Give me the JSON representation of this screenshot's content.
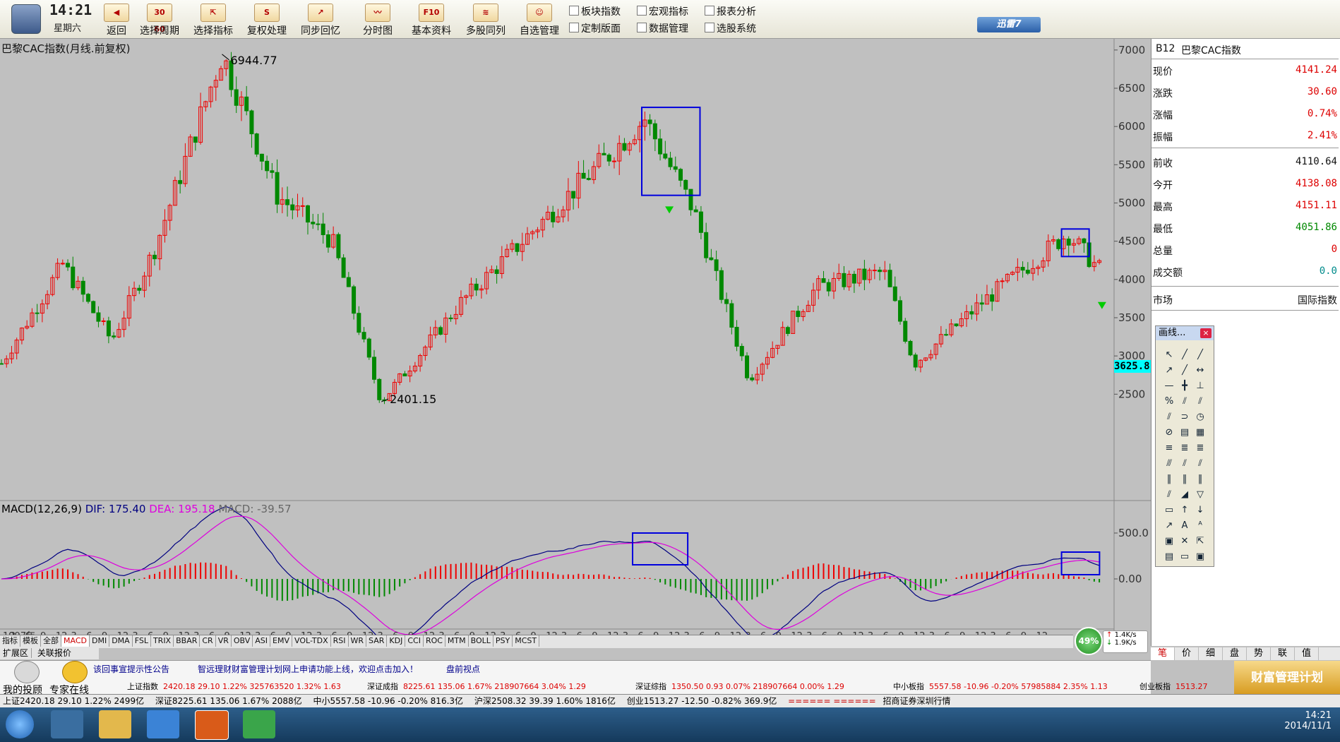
{
  "clock": {
    "time": "14:21",
    "weekday": "星期六"
  },
  "toolbar": {
    "buttons": [
      {
        "label": "返回",
        "icon": "back-arrow-icon",
        "badge": ""
      },
      {
        "label": "选择周期",
        "icon": "calendar-icon",
        "badge": "30 60"
      },
      {
        "label": "选择指标",
        "icon": "indicator-pointer-icon",
        "badge": ""
      },
      {
        "label": "复权处理",
        "icon": "restore-rights-icon",
        "badge": "S"
      },
      {
        "label": "同步回忆",
        "icon": "sync-chart-icon",
        "badge": ""
      },
      {
        "label": "分时图",
        "icon": "intraday-chart-icon",
        "badge": ""
      },
      {
        "label": "基本资料",
        "icon": "f10-icon",
        "badge": "F10"
      },
      {
        "label": "多股同列",
        "icon": "multi-stock-icon",
        "badge": ""
      },
      {
        "label": "自选管理",
        "icon": "watchlist-icon",
        "badge": ""
      }
    ],
    "mini": [
      "板块指数",
      "宏观指标",
      "报表分析",
      "定制版面",
      "数据管理",
      "选股系统"
    ],
    "xunlei": "迅雷7"
  },
  "chart": {
    "title": "巴黎CAC指数(月线.前复权)",
    "high_label": "6944.77",
    "low_label": "2401.15",
    "price_tag": "3625.8",
    "y_ticks": [
      "7000",
      "6500",
      "6000",
      "5500",
      "5000",
      "4500",
      "4000",
      "3500",
      "3000",
      "2500"
    ],
    "macd": {
      "name": "MACD(12,26,9)",
      "dif": "DIF: 175.40",
      "dea": "DEA: 195.18",
      "macd": "MACD: -39.57"
    },
    "macd_ticks": [
      "500.0",
      "0.00"
    ],
    "x_start": "1997年",
    "x_labels": [
      "3",
      "6",
      "9",
      "12",
      "3",
      "6",
      "9",
      "12",
      "3",
      "6",
      "9",
      "12",
      "3",
      "6",
      "9",
      "12",
      "3",
      "6",
      "9",
      "12",
      "3",
      "6",
      "9",
      "12",
      "3",
      "6",
      "9",
      "12",
      "3",
      "6",
      "9",
      "12",
      "3",
      "6",
      "9",
      "12",
      "3",
      "6",
      "9",
      "12",
      "3",
      "6",
      "9",
      "12",
      "3",
      "6",
      "9",
      "12",
      "3",
      "6",
      "9",
      "12",
      "3",
      "6",
      "9",
      "12",
      "3",
      "6",
      "9",
      "12",
      "3",
      "6",
      "9",
      "12",
      "3",
      "6",
      "9",
      "12"
    ]
  },
  "chart_data": {
    "type": "candlestick",
    "title": "巴黎CAC指数(月线.前复权)",
    "ylim": [
      2300,
      7100
    ],
    "approx_close_path": [
      {
        "x": 1997.0,
        "y": 2900
      },
      {
        "x": 1998.0,
        "y": 4200
      },
      {
        "x": 1998.8,
        "y": 3200
      },
      {
        "x": 1999.5,
        "y": 4400
      },
      {
        "x": 2000.6,
        "y": 6944.77
      },
      {
        "x": 2001.5,
        "y": 5100
      },
      {
        "x": 2002.4,
        "y": 4500
      },
      {
        "x": 2003.2,
        "y": 2401.15
      },
      {
        "x": 2004.5,
        "y": 3700
      },
      {
        "x": 2005.5,
        "y": 4500
      },
      {
        "x": 2006.5,
        "y": 5300
      },
      {
        "x": 2007.5,
        "y": 6100
      },
      {
        "x": 2008.3,
        "y": 4900
      },
      {
        "x": 2009.2,
        "y": 2700
      },
      {
        "x": 2010.3,
        "y": 3900
      },
      {
        "x": 2011.4,
        "y": 4100
      },
      {
        "x": 2011.9,
        "y": 2900
      },
      {
        "x": 2013.0,
        "y": 3700
      },
      {
        "x": 2014.4,
        "y": 4600
      },
      {
        "x": 2014.9,
        "y": 4141.24
      }
    ],
    "macd_summary": {
      "DIF": 175.4,
      "DEA": 195.18,
      "MACD": -39.57
    }
  },
  "quote": {
    "code": "B12",
    "name": "巴黎CAC指数",
    "rows": [
      {
        "k": "现价",
        "v": "4141.24",
        "c": "red"
      },
      {
        "k": "涨跌",
        "v": "30.60",
        "c": "red"
      },
      {
        "k": "涨幅",
        "v": "0.74%",
        "c": "red"
      },
      {
        "k": "振幅",
        "v": "2.41%",
        "c": "red"
      },
      {
        "k": "前收",
        "v": "4110.64",
        "c": "black"
      },
      {
        "k": "今开",
        "v": "4138.08",
        "c": "red"
      },
      {
        "k": "最高",
        "v": "4151.11",
        "c": "red"
      },
      {
        "k": "最低",
        "v": "4051.86",
        "c": "green"
      },
      {
        "k": "总量",
        "v": "0",
        "c": "red"
      },
      {
        "k": "成交额",
        "v": "0.0",
        "c": "teal"
      }
    ],
    "market_k": "市场",
    "market_v": "国际指数"
  },
  "palette": {
    "title": "画线...",
    "close": "×"
  },
  "tabs": [
    "指标",
    "模板",
    "全部",
    "MACD",
    "DMI",
    "DMA",
    "FSL",
    "TRIX",
    "BBAR",
    "CR",
    "VR",
    "OBV",
    "ASI",
    "EMV",
    "VOL-TDX",
    "RSI",
    "WR",
    "SAR",
    "KDJ",
    "CCI",
    "ROC",
    "MTM",
    "BOLL",
    "PSY",
    "MCST"
  ],
  "subtabs": [
    "扩展区",
    "关联报价"
  ],
  "rtabs": [
    "笔",
    "价",
    "细",
    "盘",
    "势",
    "联",
    "值"
  ],
  "netspeed": {
    "pct": "49%",
    "up": "1.4K/s",
    "down": "1.9K/s"
  },
  "bottom": {
    "invest_label": "我的投顾",
    "expert_label": "专家在线",
    "notice1": "该回事宣提示性公告",
    "notice2": "智远理财财富管理计划网上申请功能上线，欢迎点击加入！",
    "notice3": "盘前视点",
    "tickers": [
      {
        "name": "上证指数",
        "v": "2420.18  29.10  1.22%  325763520  1.32%  1.63"
      },
      {
        "name": "深证成指",
        "v": "8225.61  135.06  1.67%  218907664  3.04%  1.29"
      },
      {
        "name": "深证综指",
        "v": "1350.50  0.93  0.07%  218907664  0.00%  1.29"
      },
      {
        "name": "中小板指",
        "v": "5557.58  -10.96  -0.20%  57985884  2.35%  1.13"
      },
      {
        "name": "创业板指",
        "v": "1513.27"
      }
    ],
    "banner": "财富管理计划"
  },
  "status": {
    "s1": "上证2420.18  29.10  1.22%  2499亿",
    "s2": "深证8225.61  135.06  1.67%  2088亿",
    "s3": "中小5557.58  -10.96  -0.20%  816.3亿",
    "s4": "沪深2508.32  39.39  1.60%  1816亿",
    "s5": "创业1513.27  -12.50  -0.82%  369.9亿",
    "s6": "招商证券深圳行情"
  },
  "taskbar": {
    "time": "14:21",
    "date": "2014/11/1"
  },
  "colors": {
    "up": "#ee0000",
    "down": "#008800",
    "dif": "#000080",
    "dea": "#dd00dd",
    "box": "#0000dd",
    "bg": "#c0c0c0"
  }
}
